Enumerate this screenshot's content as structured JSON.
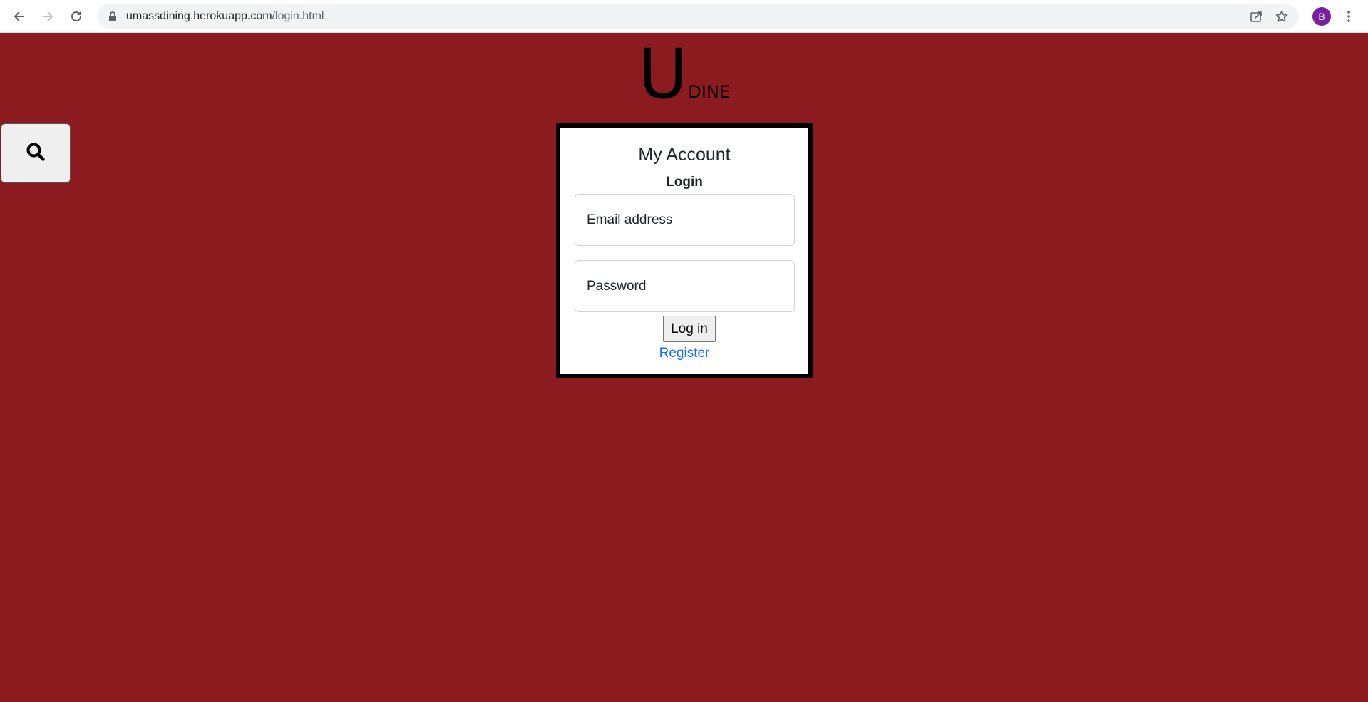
{
  "browser": {
    "url_host": "umassdining.herokuapp.com",
    "url_path": "/login.html",
    "profile_initial": "B",
    "icons": [
      "back-arrow-icon",
      "forward-arrow-icon",
      "reload-icon",
      "lock-icon",
      "share-icon",
      "bookmark-star-icon",
      "kebab-menu-icon"
    ]
  },
  "colors": {
    "page_background": "#8b1b1e",
    "card_background": "#ffffff",
    "card_border": "#000000",
    "link": "#0d6efd",
    "profile_avatar": "#7b1fa2"
  },
  "logo": {
    "big_letter": "U",
    "small_text": "DINE"
  },
  "search": {
    "icon": "search-icon"
  },
  "account_card": {
    "title": "My Account",
    "subtitle": "Login",
    "email_placeholder": "Email address",
    "email_value": "",
    "password_placeholder": "Password",
    "password_value": "",
    "login_label": "Log in",
    "register_label": "Register"
  }
}
